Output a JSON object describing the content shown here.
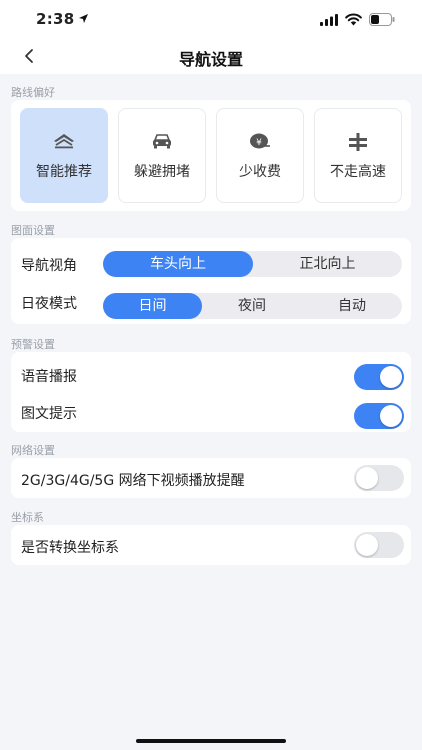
{
  "status": {
    "time": "2:38"
  },
  "header": {
    "title": "导航设置"
  },
  "route": {
    "section": "路线偏好",
    "options": [
      {
        "label": "智能推荐",
        "active": true
      },
      {
        "label": "躲避拥堵",
        "active": false
      },
      {
        "label": "少收费",
        "active": false
      },
      {
        "label": "不走高速",
        "active": false
      }
    ]
  },
  "display": {
    "section": "图面设置",
    "orientation": {
      "label": "导航视角",
      "options": [
        "车头向上",
        "正北向上"
      ],
      "selected": "车头向上"
    },
    "daynight": {
      "label": "日夜模式",
      "options": [
        "日间",
        "夜间",
        "自动"
      ],
      "selected": "日间"
    }
  },
  "alerts": {
    "section": "预警设置",
    "voice": {
      "label": "语音播报",
      "on": true
    },
    "tips": {
      "label": "图文提示",
      "on": true
    }
  },
  "network": {
    "section": "网络设置",
    "video": {
      "label": "2G/3G/4G/5G 网络下视频播放提醒",
      "on": false
    }
  },
  "coords": {
    "section": "坐标系",
    "convert": {
      "label": "是否转换坐标系",
      "on": false
    }
  },
  "colors": {
    "accent": "#3d83f3",
    "selected_tile": "#cfe0fb",
    "page_bg": "#f4f5f8"
  }
}
